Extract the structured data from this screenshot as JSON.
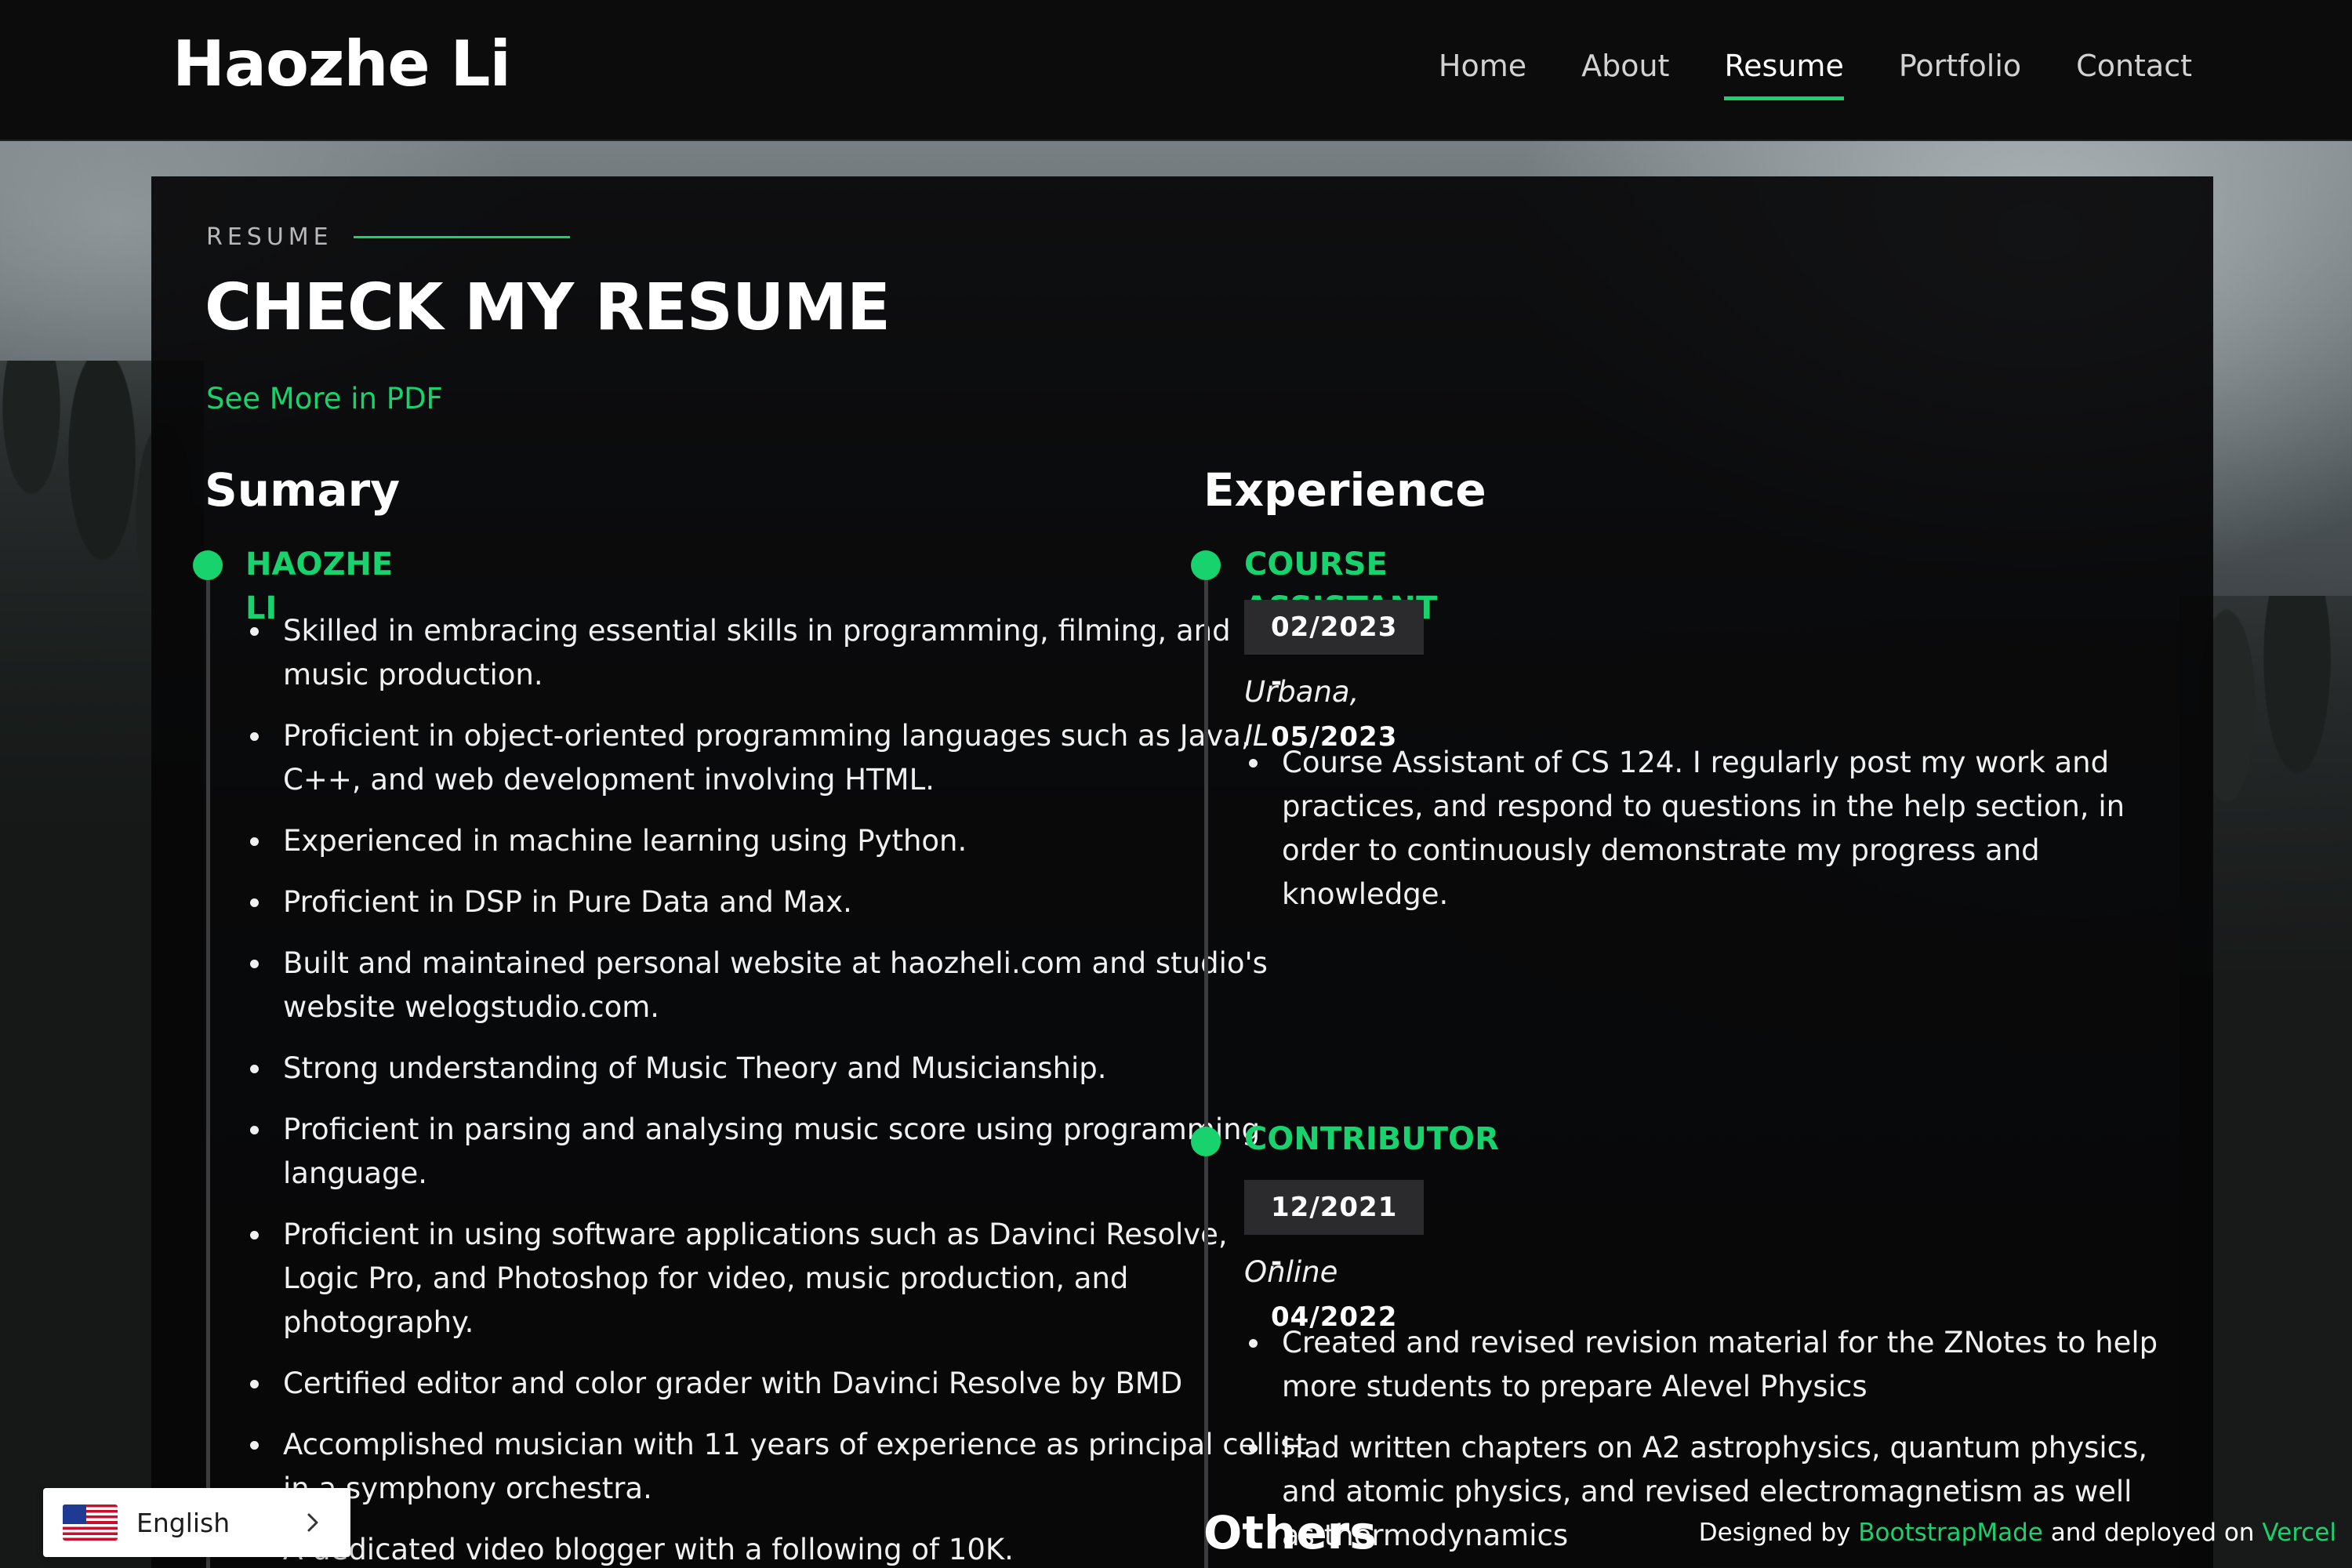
{
  "site": {
    "logo": "Haozhe Li"
  },
  "nav": {
    "items": [
      {
        "label": "Home",
        "active": false
      },
      {
        "label": "About",
        "active": false
      },
      {
        "label": "Resume",
        "active": true
      },
      {
        "label": "Portfolio",
        "active": false
      },
      {
        "label": "Contact",
        "active": false
      }
    ]
  },
  "section": {
    "tag": "RESUME",
    "title": "CHECK MY RESUME",
    "pdf_link": "See More in PDF"
  },
  "summary": {
    "title": "Sumary",
    "name": "HAOZHE LI",
    "bullets": [
      "Skilled in embracing essential skills in programming, filming, and music production.",
      "Proficient in object-oriented programming languages such as Java, C++, and web development involving HTML.",
      "Experienced in machine learning using Python.",
      "Proficient in DSP in Pure Data and Max.",
      "Built and maintained personal website at haozheli.com and studio's website welogstudio.com.",
      "Strong understanding of Music Theory and Musicianship.",
      "Proficient in parsing and analysing music score using programming language.",
      "Proficient in using software applications such as Davinci Resolve, Logic Pro, and Photoshop for video, music production, and photography.",
      "Certified editor and color grader with Davinci Resolve by BMD",
      "Accomplished musician with 11 years of experience as principal cellist in a symphony orchestra.",
      "A dedicated video blogger with a following of 10K."
    ]
  },
  "experience": {
    "title": "Experience",
    "items": [
      {
        "role": "COURSE ASSISTANT",
        "dates": "02/2023 - 05/2023",
        "location": "Urbana, IL",
        "bullets": [
          "Course Assistant of CS 124. I regularly post my work and practices, and respond to questions in the help section, in order to continuously demonstrate my progress and knowledge."
        ]
      },
      {
        "role": "CONTRIBUTOR",
        "dates": "12/2021 - 04/2022",
        "location": "Online",
        "bullets": [
          "Created and revised revision material for the ZNotes to help more students to prepare Alevel Physics",
          "Had written chapters on A2 astrophysics, quantum physics, and atomic physics, and revised electromagnetism as well as thermodynamics"
        ]
      }
    ]
  },
  "others": {
    "title": "Others"
  },
  "footer": {
    "prefix": "Designed by ",
    "bootstrap": "BootstrapMade",
    "middle": " and deployed on ",
    "vercel": "Vercel"
  },
  "language": {
    "label": "English",
    "flag": "us-flag-icon"
  },
  "colors": {
    "accent": "#18d26e",
    "panel": "#060607",
    "header": "#0c0c0d"
  }
}
